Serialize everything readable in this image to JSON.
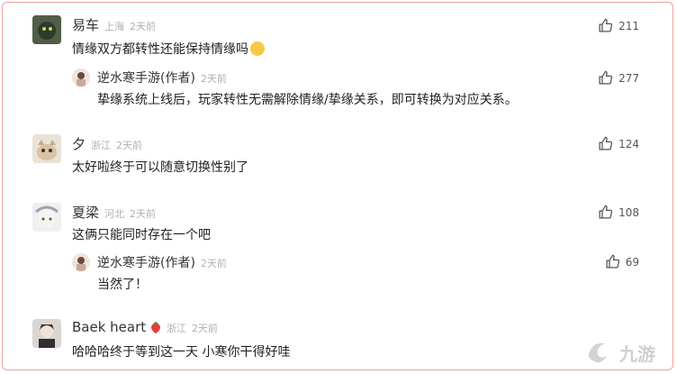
{
  "comments": [
    {
      "name": "易车",
      "location": "上海",
      "time": "2天前",
      "text": "情缘双方都转性还能保持情缘吗",
      "likes": "211",
      "reply": {
        "name": "逆水寒手游(作者)",
        "time": "2天前",
        "text": "挚缘系统上线后，玩家转性无需解除情缘/挚缘关系，即可转换为对应关系。",
        "likes": "277"
      }
    },
    {
      "name": "夕",
      "location": "浙江",
      "time": "2天前",
      "text": "太好啦终于可以随意切换性别了",
      "likes": "124"
    },
    {
      "name": "夏梁",
      "location": "河北",
      "time": "2天前",
      "text": "这俩只能同时存在一个吧",
      "likes": "108",
      "reply": {
        "name": "逆水寒手游(作者)",
        "time": "2天前",
        "text": "当然了！",
        "likes": "69"
      }
    },
    {
      "name": "Baek heart",
      "location": "浙江",
      "time": "2天前",
      "text": "哈哈哈终于等到这一天 小寒你干得好哇",
      "likes": ""
    }
  ],
  "colors": {
    "border": "#f0a0a0",
    "meta": "#b0b0b0",
    "text": "#222222"
  }
}
